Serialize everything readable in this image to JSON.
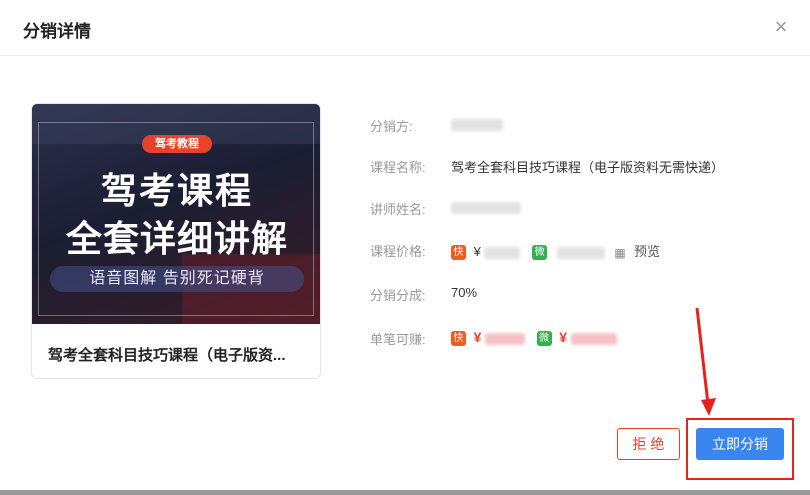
{
  "dialog": {
    "title": "分销详情",
    "close_symbol": "×"
  },
  "course_card": {
    "badge": "驾考教程",
    "headline_1": "驾考课程",
    "headline_2": "全套详细讲解",
    "subline": "语音图解 告别死记硬背",
    "name": "驾考全套科目技巧课程（电子版资..."
  },
  "details": {
    "distributor_label": "分销方:",
    "course_name_label": "课程名称:",
    "course_name_value": "驾考全套科目技巧课程（电子版资料无需快递）",
    "teacher_label": "讲师姓名:",
    "price_label": "课程价格:",
    "price_kuaishou_prefix": "¥",
    "price_kuaishou_icon": "快",
    "price_wechat_icon": "微",
    "preview_label": "预览",
    "share_label": "分销分成:",
    "share_value": "70%",
    "earn_label": "单笔可赚:",
    "earn_kuaishou_prefix": "¥",
    "earn_wechat_prefix": "¥"
  },
  "actions": {
    "reject_label": "拒 绝",
    "distribute_label": "立即分销"
  },
  "colors": {
    "accent_blue": "#3a86f0",
    "reject_red": "#e8412c",
    "annotation_red": "#e8211c"
  }
}
